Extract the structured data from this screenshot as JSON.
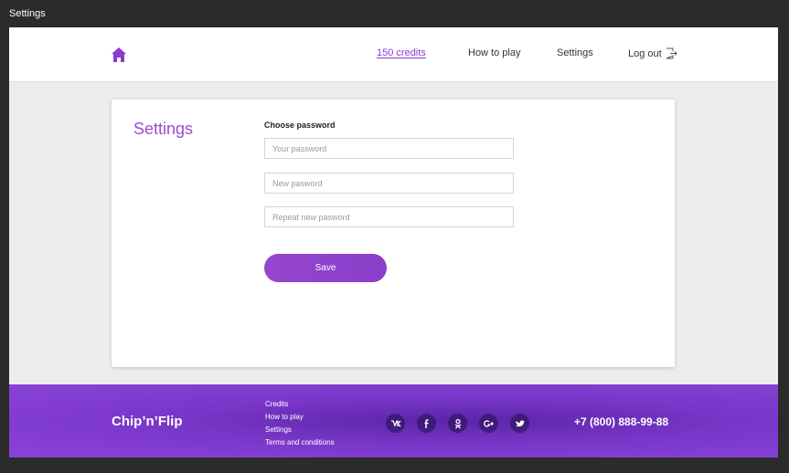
{
  "window": {
    "title": "Settings"
  },
  "header": {
    "home_icon": "home-icon",
    "credits": "150 credits",
    "how_to_play": "How to play",
    "settings": "Settings",
    "logout": "Log out",
    "logout_icon": "logout-icon",
    "accent": "#8a3bd0"
  },
  "settings_card": {
    "title": "Settings",
    "section_label": "Choose password",
    "current_password_placeholder": "Your password",
    "new_password_placeholder": "New pasword",
    "repeat_password_placeholder": "Repeat new pasword",
    "save_label": "Save"
  },
  "footer": {
    "brand": "Chip’n’Flip",
    "links": [
      "Credits",
      "How to play",
      "Settings",
      "Terms and conditions"
    ],
    "socials": [
      {
        "name": "vk-icon",
        "glyph": "vk"
      },
      {
        "name": "facebook-icon",
        "glyph": "f"
      },
      {
        "name": "odnoklassniki-icon",
        "glyph": "ok"
      },
      {
        "name": "google-plus-icon",
        "glyph": "G+"
      },
      {
        "name": "twitter-icon",
        "glyph": "tw"
      }
    ],
    "phone": "+7 (800) 888-99-88"
  }
}
